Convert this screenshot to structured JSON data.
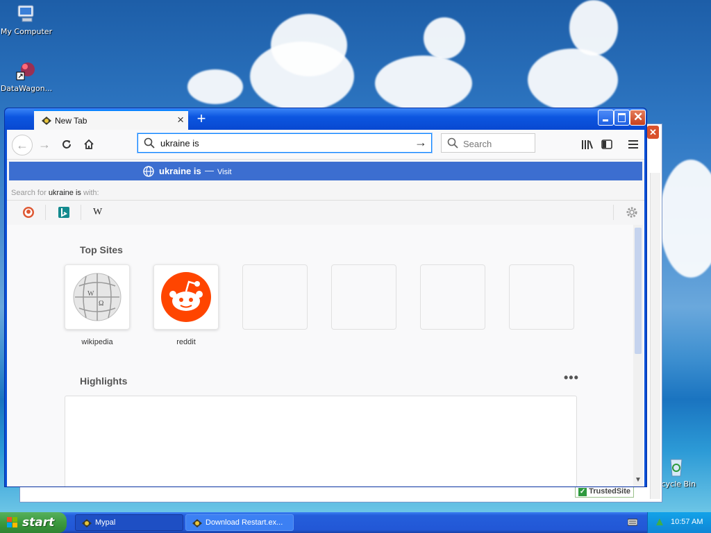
{
  "desktop": {
    "icons": [
      {
        "label": "My Computer"
      },
      {
        "label": "DataWagon..."
      },
      {
        "label": "ecycle Bin"
      }
    ]
  },
  "background_window": {
    "trusted_label": "TrustedSite"
  },
  "browser": {
    "tab": {
      "title": "New Tab"
    },
    "urlbar": {
      "value": "ukraine is"
    },
    "searchbox": {
      "placeholder": "Search"
    },
    "suggestion": {
      "text": "ukraine is",
      "separator": "—",
      "action": "Visit"
    },
    "search_for": {
      "prefix": "Search for",
      "query": "ukraine is",
      "suffix": "with:"
    },
    "engines": [
      "DuckDuckGo",
      "Bing",
      "Wikipedia"
    ],
    "engine_wiki_glyph": "W",
    "content": {
      "top_sites_title": "Top Sites",
      "top_sites": [
        {
          "label": "wikipedia",
          "icon": "wikipedia-globe-icon"
        },
        {
          "label": "reddit",
          "icon": "reddit-alien-icon"
        }
      ],
      "highlights_title": "Highlights",
      "more_glyph": "•••"
    }
  },
  "taskbar": {
    "start_label": "start",
    "tasks": [
      {
        "label": "Mypal"
      },
      {
        "label": "Download Restart.ex..."
      }
    ],
    "clock": "10:57 AM"
  },
  "colors": {
    "accent": "#0a84ff",
    "suggestion_bg": "#3c6ed0",
    "xp_titlebar": "#0848d1",
    "reddit": "#ff4500"
  }
}
